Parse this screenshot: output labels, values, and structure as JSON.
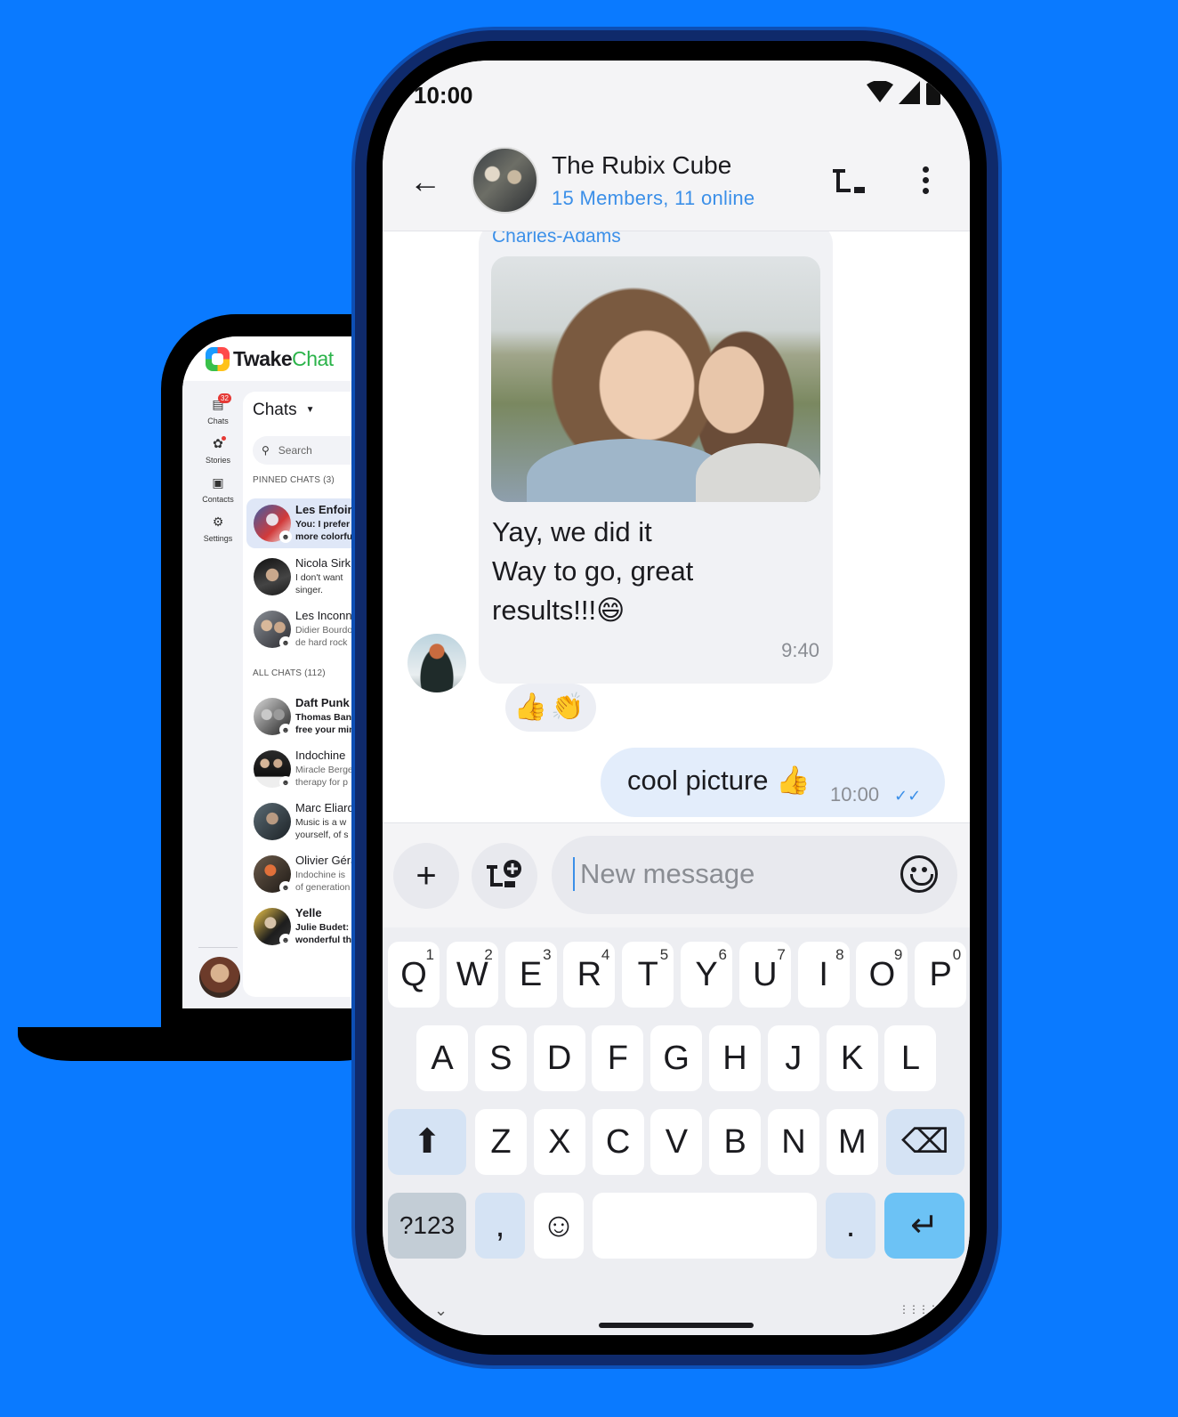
{
  "desktop": {
    "brand_part1": "Twake",
    "brand_part2": "Chat",
    "rail": [
      {
        "label": "Chats",
        "icon": "chat-bubble-icon",
        "badge": "32"
      },
      {
        "label": "Stories",
        "icon": "stories-icon"
      },
      {
        "label": "Contacts",
        "icon": "contacts-icon"
      },
      {
        "label": "Settings",
        "icon": "gear-icon"
      }
    ],
    "list_title": "Chats",
    "search_placeholder": "Search",
    "pinned_header": "PINNED CHATS (3)",
    "all_header": "ALL CHATS (112)",
    "pinned": [
      {
        "name": "Les Enfoirés",
        "preview": "You: I prefer\nmore colorful"
      },
      {
        "name": "Nicola Sirkis",
        "preview": "I don't want\nsinger."
      },
      {
        "name": "Les Inconnus",
        "preview": "Didier Bourdon\nde hard rock"
      }
    ],
    "all": [
      {
        "name": "Daft Punk",
        "preview": "Thomas Bangalter\nfree your mind"
      },
      {
        "name": "Indochine",
        "preview": "Miracle Berger\ntherapy for p"
      },
      {
        "name": "Marc Eliard",
        "preview": "Music is a w\nyourself, of s"
      },
      {
        "name": "Olivier Gérard",
        "preview": "Indochine is\nof generation"
      },
      {
        "name": "Yelle",
        "preview": "Julie Budet:\nwonderful th"
      }
    ]
  },
  "phone": {
    "status_time": "10:00",
    "group_name": "The Rubix Cube",
    "group_sub": "15 Members, 11 online",
    "incoming": {
      "sender": "Charles-Adams",
      "text": "Yay, we did it\nWay to go, great\nresults!!!😄",
      "time": "9:40",
      "reactions": "👍👏"
    },
    "outgoing": {
      "text": "cool picture 👍",
      "time": "10:00",
      "check": "✓✓"
    },
    "composer_placeholder": "New message",
    "keyboard": {
      "row1": [
        "Q",
        "W",
        "E",
        "R",
        "T",
        "Y",
        "U",
        "I",
        "O",
        "P"
      ],
      "row1_hints": [
        "1",
        "2",
        "3",
        "4",
        "5",
        "6",
        "7",
        "8",
        "9",
        "0"
      ],
      "row2": [
        "A",
        "S",
        "D",
        "F",
        "G",
        "H",
        "J",
        "K",
        "L"
      ],
      "row3": [
        "Z",
        "X",
        "C",
        "V",
        "B",
        "N",
        "M"
      ],
      "sym_label": "?123",
      "comma": ",",
      "period": "."
    }
  }
}
